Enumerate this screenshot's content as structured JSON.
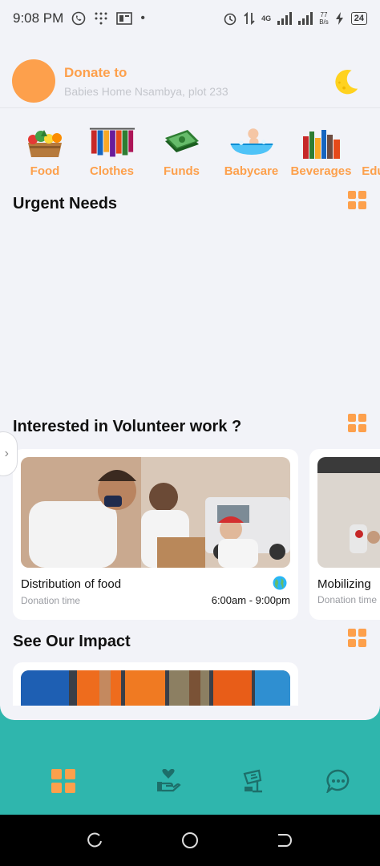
{
  "status_bar": {
    "time": "9:08 PM",
    "network_speed_value": "77",
    "network_speed_unit": "B/s",
    "network_type": "4G",
    "battery": "24"
  },
  "header": {
    "donate_label": "Donate to",
    "place": "Babies Home Nsambya, plot 233"
  },
  "categories": [
    {
      "label": "Food",
      "icon": "food-basket"
    },
    {
      "label": "Clothes",
      "icon": "clothes-rack"
    },
    {
      "label": "Funds",
      "icon": "money-stack"
    },
    {
      "label": "Babycare",
      "icon": "baby-bath"
    },
    {
      "label": "Beverages",
      "icon": "drinks"
    },
    {
      "label": "Education",
      "icon": "education"
    }
  ],
  "sections": {
    "urgent_needs": "Urgent Needs",
    "volunteer": "Interested in Volunteer work ?",
    "impact": "See Our Impact"
  },
  "volunteer_cards": [
    {
      "title": "Distribution of food",
      "subtitle": "Donation time",
      "time": "6:00am - 9:00pm"
    },
    {
      "title": "Mobilizing",
      "subtitle": "Donation time",
      "time": ""
    }
  ],
  "colors": {
    "accent": "#fda04c",
    "nav_bg": "#2fb6ad",
    "nav_icon": "#1d6f6a",
    "page_bg": "#f2f3f8"
  },
  "bottom_nav": [
    {
      "icon": "dashboard-icon",
      "active": true
    },
    {
      "icon": "donate-hand-heart-icon",
      "active": false
    },
    {
      "icon": "volunteer-sign-icon",
      "active": false
    },
    {
      "icon": "chat-icon",
      "active": false
    }
  ]
}
